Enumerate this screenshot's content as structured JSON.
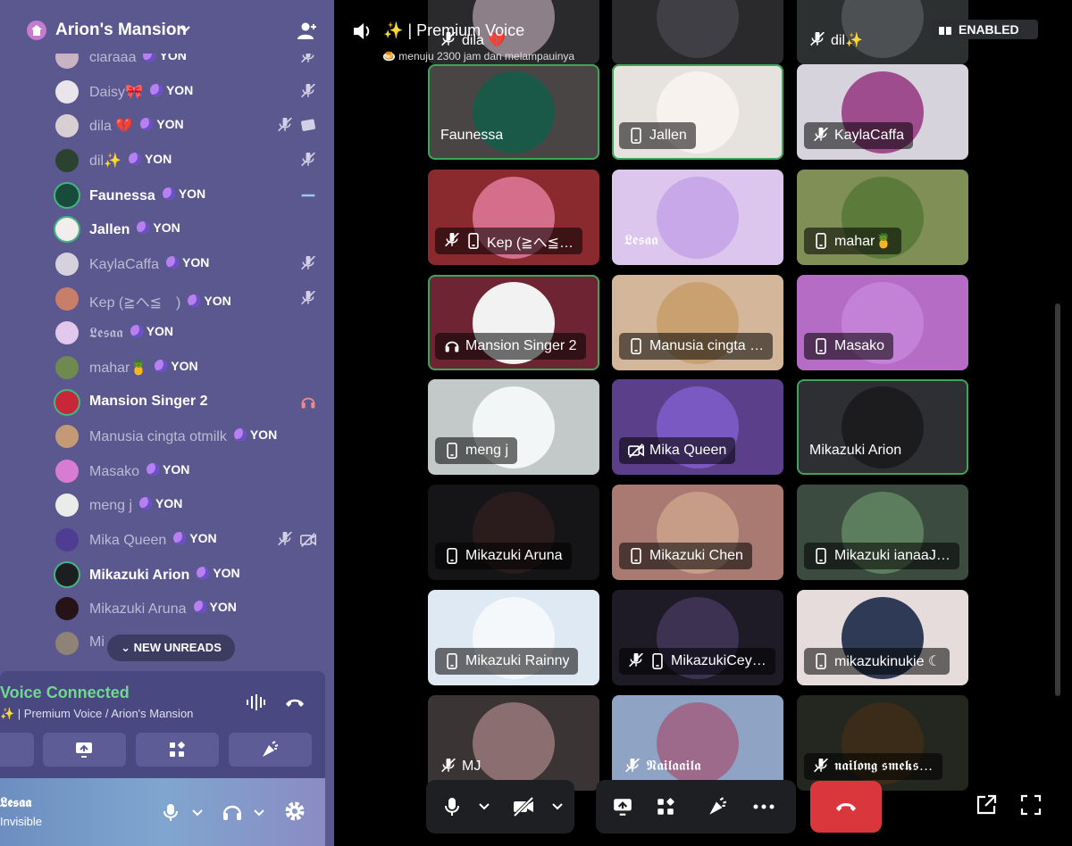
{
  "server": {
    "name": "Arion's Mansion"
  },
  "new_unreads": "NEW UNREADS",
  "members": [
    {
      "name": "claraaa",
      "tag": "YON",
      "bold": false,
      "color": "#c9b3c2",
      "icons": [
        "mute"
      ]
    },
    {
      "name": "Daisy🎀",
      "tag": "YON",
      "bold": false,
      "color": "#e9e5ea",
      "icons": [
        "mute"
      ]
    },
    {
      "name": "dila 💔",
      "tag": "YON",
      "bold": false,
      "color": "#d9cfd3",
      "icons": [
        "mute",
        "screen"
      ]
    },
    {
      "name": "dil✨",
      "tag": "YON",
      "bold": false,
      "color": "#2b4230",
      "icons": [
        "mute"
      ]
    },
    {
      "name": "Faunessa",
      "tag": "YON",
      "bold": true,
      "color": "#184b3c",
      "icons": [
        "speaking"
      ]
    },
    {
      "name": "Jallen",
      "tag": "YON",
      "bold": true,
      "color": "#f4eded",
      "icons": []
    },
    {
      "name": "KaylaCaffa",
      "tag": "YON",
      "bold": false,
      "color": "#d5d2dd",
      "icons": [
        "mute"
      ]
    },
    {
      "name": "Kep (≧へ≦　)",
      "tag": "YON",
      "bold": false,
      "color": "#c97e6a",
      "icons": [
        "mute"
      ]
    },
    {
      "name": "𝕷𝖊𝖘𝖆𝖆",
      "tag": "YON",
      "bold": false,
      "color": "#e2c8ec",
      "icons": []
    },
    {
      "name": "mahar🍍",
      "tag": "YON",
      "bold": false,
      "color": "#6f8a4f",
      "icons": []
    },
    {
      "name": "Mansion Singer 2",
      "tag": "",
      "bold": true,
      "color": "#c8273a",
      "icons": [
        "headphone"
      ]
    },
    {
      "name": "Manusia cingta otmilk",
      "tag": "YON",
      "bold": false,
      "color": "#c49a76",
      "icons": []
    },
    {
      "name": "Masako",
      "tag": "YON",
      "bold": false,
      "color": "#d77cd2",
      "icons": []
    },
    {
      "name": "meng j",
      "tag": "YON",
      "bold": false,
      "color": "#e9ece9",
      "icons": []
    },
    {
      "name": "Mika Queen",
      "tag": "YON",
      "bold": false,
      "color": "#4f3d93",
      "icons": [
        "mute",
        "camoff"
      ]
    },
    {
      "name": "Mikazuki Arion",
      "tag": "YON",
      "bold": true,
      "color": "#1d1e22",
      "icons": []
    },
    {
      "name": "Mikazuki Aruna",
      "tag": "YON",
      "bold": false,
      "color": "#251317",
      "icons": []
    },
    {
      "name": "Mi",
      "tag": "",
      "bold": false,
      "color": "#8f8276",
      "icons": []
    }
  ],
  "voice": {
    "status": "Voice Connected",
    "sub": "✨ | Premium Voice / Arion's Mansion"
  },
  "user": {
    "name": "𝕷𝖊𝖘𝖆𝖆",
    "status": "Invisible"
  },
  "channel": {
    "emoji": "✨",
    "title": "| Premium Voice",
    "status_text": "🍮 menuju 2300 jam dan melampauinya",
    "badge": "ENABLED"
  },
  "tiles": [
    {
      "name": "dila 💔",
      "bg": "#2a2a2c",
      "av": "#8c7f88",
      "speak": false,
      "icons": [
        "mute"
      ],
      "plain": true
    },
    {
      "name": "",
      "bg": "#2a2a2c",
      "av": "#3f3f45",
      "speak": false,
      "icons": [],
      "plain": true
    },
    {
      "name": "dil✨",
      "bg": "#2d3030",
      "av": "#4c5052",
      "speak": false,
      "icons": [
        "mute"
      ],
      "plain": true
    },
    {
      "name": "Faunessa",
      "bg": "#4a4545",
      "av": "#1a5948",
      "speak": true,
      "icons": [],
      "plain": true
    },
    {
      "name": "Jallen",
      "bg": "#e6e2de",
      "av": "#f8f2ef",
      "speak": true,
      "icons": [
        "phone"
      ],
      "plain": false
    },
    {
      "name": "KaylaCaffa",
      "bg": "#d6d3dc",
      "av": "#9f4c8f",
      "speak": false,
      "icons": [
        "mute"
      ],
      "plain": false
    },
    {
      "name": "Kep (≧へ≦…",
      "bg": "#8a2a2f",
      "av": "#d46e8a",
      "speak": false,
      "icons": [
        "mute",
        "phone"
      ],
      "plain": false
    },
    {
      "name": "𝕷𝖊𝖘𝖆𝖆",
      "bg": "#dcc6ee",
      "av": "#c8a8e8",
      "speak": false,
      "icons": [],
      "plain": true
    },
    {
      "name": "mahar🍍",
      "bg": "#7f8f56",
      "av": "#5c7a3a",
      "speak": false,
      "icons": [
        "phone"
      ],
      "plain": false
    },
    {
      "name": "Mansion Singer 2",
      "bg": "#6e2432",
      "av": "#f2f2f2",
      "speak": true,
      "icons": [
        "headphone"
      ],
      "plain": false
    },
    {
      "name": "Manusia cingta …",
      "bg": "#d4b79a",
      "av": "#c9a070",
      "speak": false,
      "icons": [
        "phone"
      ],
      "plain": false
    },
    {
      "name": "Masako",
      "bg": "#b46cc4",
      "av": "#c482d6",
      "speak": false,
      "icons": [
        "phone"
      ],
      "plain": false
    },
    {
      "name": "meng j",
      "bg": "#c3c9c9",
      "av": "#f2f6f7",
      "speak": false,
      "icons": [
        "phone"
      ],
      "plain": false
    },
    {
      "name": "Mika Queen",
      "bg": "#5b3f8b",
      "av": "#7a5ac2",
      "speak": false,
      "icons": [
        "camoff"
      ],
      "plain": false
    },
    {
      "name": "Mikazuki Arion",
      "bg": "#2e2f32",
      "av": "#1c1c1f",
      "speak": true,
      "icons": [],
      "plain": true
    },
    {
      "name": "Mikazuki Aruna",
      "bg": "#151417",
      "av": "#2a1b1d",
      "speak": false,
      "icons": [
        "phone"
      ],
      "plain": false
    },
    {
      "name": "Mikazuki Chen",
      "bg": "#a87a72",
      "av": "#c79d88",
      "speak": false,
      "icons": [
        "phone"
      ],
      "plain": false
    },
    {
      "name": "Mikazuki ianaaJ…",
      "bg": "#3c4b40",
      "av": "#5d7e5c",
      "speak": false,
      "icons": [
        "phone"
      ],
      "plain": false
    },
    {
      "name": "Mikazuki Rainny",
      "bg": "#dfe9f3",
      "av": "#f5f8fb",
      "speak": false,
      "icons": [
        "phone"
      ],
      "plain": false
    },
    {
      "name": "MikazukiCey…",
      "bg": "#1e1b26",
      "av": "#3d3252",
      "speak": false,
      "icons": [
        "mute",
        "phone"
      ],
      "plain": false
    },
    {
      "name": "mikazukinukie ☾",
      "bg": "#e6dcdc",
      "av": "#2f3a57",
      "speak": false,
      "icons": [
        "phone"
      ],
      "plain": false
    },
    {
      "name": "MJ",
      "bg": "#3a3434",
      "av": "#8a6e70",
      "speak": false,
      "icons": [
        "mute"
      ],
      "plain": true
    },
    {
      "name": "𝕹𝖆𝖎𝖑𝖆𝖆𝖎𝖑𝖆",
      "bg": "#8fa4c5",
      "av": "#9e6a8c",
      "speak": false,
      "icons": [
        "mute"
      ],
      "plain": true
    },
    {
      "name": "𝖓𝖆𝖎𝖑𝖔𝖓𝖌 𝖘𝖒𝖊𝖐𝖘…",
      "bg": "#242620",
      "av": "#3a2c18",
      "speak": false,
      "icons": [
        "mute"
      ],
      "plain": false
    }
  ]
}
